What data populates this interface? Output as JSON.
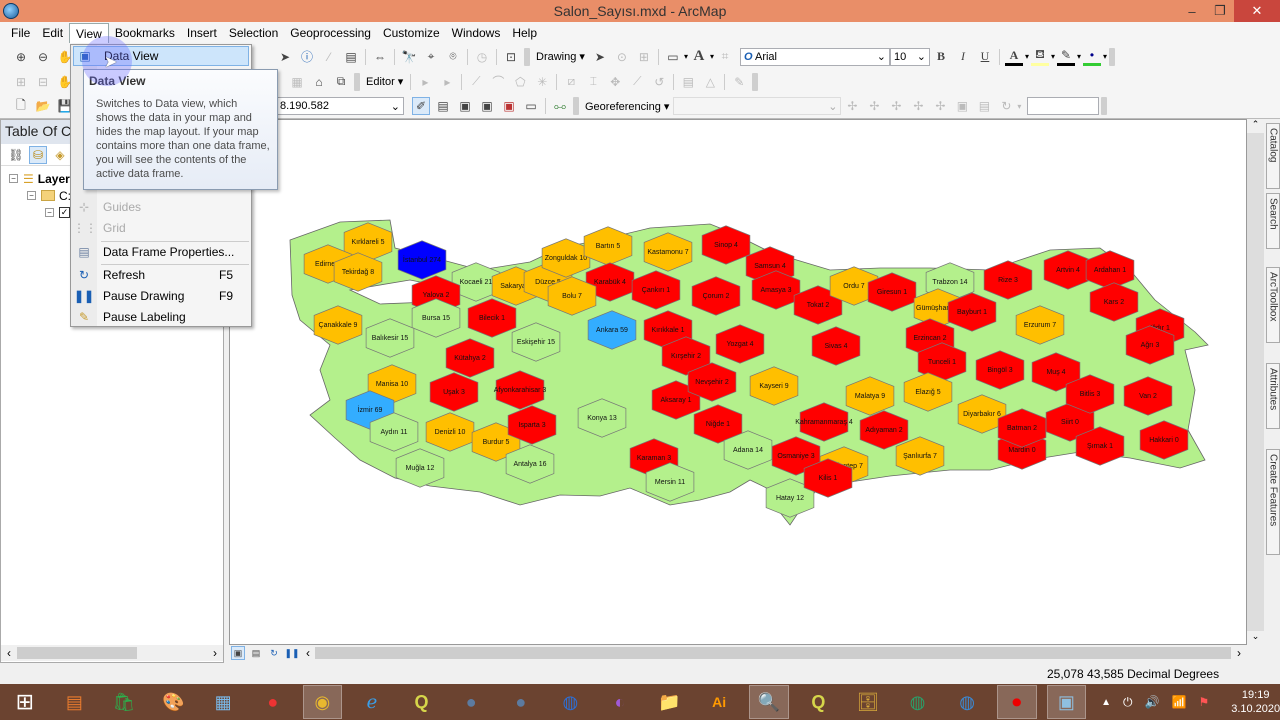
{
  "window": {
    "title": "Salon_Sayısı.mxd - ArcMap",
    "minimize": "–",
    "restore": "❐",
    "close": "✕"
  },
  "menu": [
    "File",
    "Edit",
    "View",
    "Bookmarks",
    "Insert",
    "Selection",
    "Geoprocessing",
    "Customize",
    "Windows",
    "Help"
  ],
  "toolbar": {
    "drawing_label": "Drawing",
    "font_name": "Arial",
    "font_size": "10",
    "bold": "B",
    "italic": "I",
    "underline": "U",
    "editor_label": "Editor",
    "scale_value": "8.190.582",
    "georef_label": "Georeferencing",
    "georef_layer": ""
  },
  "view_menu": {
    "items": [
      {
        "label": "Data View",
        "icon": "data-view-icon",
        "highlight": true
      },
      {
        "label": "Guides",
        "icon": "guides-icon",
        "disabled": true
      },
      {
        "label": "Grid",
        "icon": "grid-icon",
        "disabled": true
      },
      {
        "label": "Data Frame Properties...",
        "icon": "data-frame-properties-icon"
      },
      {
        "label": "Refresh",
        "icon": "refresh-icon",
        "shortcut": "F5"
      },
      {
        "label": "Pause Drawing",
        "icon": "pause-icon",
        "shortcut": "F9"
      },
      {
        "label": "Pause Labeling",
        "icon": "pause-labeling-icon"
      }
    ]
  },
  "tooltip": {
    "title": "Data View",
    "body": "Switches to Data view, which shows the data in your map and hides the map layout. If your map contains more than one data frame, you will see the contents of the active data frame."
  },
  "toc": {
    "title": "Table Of C",
    "layers_label": "Layer",
    "folder_label": "C:"
  },
  "side_tabs": [
    "Catalog",
    "Search",
    "ArcToolbox",
    "Attributes",
    "Create Features"
  ],
  "status": {
    "coords": "25,078  43,585 Decimal Degrees"
  },
  "taskbar": {
    "time": "19:19",
    "date": "3.10.2020"
  },
  "map": {
    "legend_colors": {
      "very_high": "#0000ff",
      "high": "#33adff",
      "medium": "#b4f08c",
      "low": "#ffbf00",
      "very_low": "#ff0000"
    },
    "provinces": [
      {
        "name": "Kırklareli",
        "value": 5,
        "cls": "low"
      },
      {
        "name": "Edirne",
        "value": 6,
        "cls": "low"
      },
      {
        "name": "Tekirdağ",
        "value": 8,
        "cls": "low"
      },
      {
        "name": "İstanbul",
        "value": 274,
        "cls": "very_high"
      },
      {
        "name": "Kocaeli",
        "value": 21,
        "cls": "medium"
      },
      {
        "name": "Yalova",
        "value": 2,
        "cls": "very_low"
      },
      {
        "name": "Sakarya",
        "value": 7,
        "cls": "low"
      },
      {
        "name": "Düzce",
        "value": 5,
        "cls": "low"
      },
      {
        "name": "Zonguldak",
        "value": 10,
        "cls": "low"
      },
      {
        "name": "Bartın",
        "value": 5,
        "cls": "low"
      },
      {
        "name": "Karabük",
        "value": 4,
        "cls": "very_low"
      },
      {
        "name": "Kastamonu",
        "value": 7,
        "cls": "low"
      },
      {
        "name": "Sinop",
        "value": 4,
        "cls": "very_low"
      },
      {
        "name": "Samsun",
        "value": 4,
        "cls": "very_low"
      },
      {
        "name": "Bolu",
        "value": 7,
        "cls": "low"
      },
      {
        "name": "Çanakkale",
        "value": 9,
        "cls": "low"
      },
      {
        "name": "Bursa",
        "value": 15,
        "cls": "medium"
      },
      {
        "name": "Balıkesir",
        "value": 15,
        "cls": "medium"
      },
      {
        "name": "Bilecik",
        "value": 1,
        "cls": "very_low"
      },
      {
        "name": "Eskişehir",
        "value": 15,
        "cls": "medium"
      },
      {
        "name": "Ankara",
        "value": 59,
        "cls": "high"
      },
      {
        "name": "Çankırı",
        "value": 1,
        "cls": "very_low"
      },
      {
        "name": "Çorum",
        "value": 2,
        "cls": "very_low"
      },
      {
        "name": "Amasya",
        "value": 3,
        "cls": "very_low"
      },
      {
        "name": "Tokat",
        "value": 2,
        "cls": "very_low"
      },
      {
        "name": "Ordu",
        "value": 7,
        "cls": "low"
      },
      {
        "name": "Giresun",
        "value": 1,
        "cls": "very_low"
      },
      {
        "name": "Trabzon",
        "value": 14,
        "cls": "medium"
      },
      {
        "name": "Rize",
        "value": 3,
        "cls": "very_low"
      },
      {
        "name": "Artvin",
        "value": 4,
        "cls": "very_low"
      },
      {
        "name": "Ardahan",
        "value": 1,
        "cls": "very_low"
      },
      {
        "name": "Gümüşhane",
        "value": 6,
        "cls": "low"
      },
      {
        "name": "Bayburt",
        "value": 1,
        "cls": "very_low"
      },
      {
        "name": "Erzurum",
        "value": 7,
        "cls": "low"
      },
      {
        "name": "Kars",
        "value": 2,
        "cls": "very_low"
      },
      {
        "name": "Iğdır",
        "value": 1,
        "cls": "very_low"
      },
      {
        "name": "Ağrı",
        "value": 3,
        "cls": "very_low"
      },
      {
        "name": "Kırıkkale",
        "value": 1,
        "cls": "very_low"
      },
      {
        "name": "Yozgat",
        "value": 4,
        "cls": "very_low"
      },
      {
        "name": "Sivas",
        "value": 4,
        "cls": "very_low"
      },
      {
        "name": "Erzincan",
        "value": 2,
        "cls": "very_low"
      },
      {
        "name": "Tunceli",
        "value": 1,
        "cls": "very_low"
      },
      {
        "name": "Bingöl",
        "value": 3,
        "cls": "very_low"
      },
      {
        "name": "Muş",
        "value": 4,
        "cls": "very_low"
      },
      {
        "name": "Kırşehir",
        "value": 2,
        "cls": "very_low"
      },
      {
        "name": "Kütahya",
        "value": 2,
        "cls": "very_low"
      },
      {
        "name": "Manisa",
        "value": 10,
        "cls": "low"
      },
      {
        "name": "İzmir",
        "value": 69,
        "cls": "high"
      },
      {
        "name": "Uşak",
        "value": 3,
        "cls": "very_low"
      },
      {
        "name": "Afyonkarahisar",
        "value": 3,
        "cls": "very_low"
      },
      {
        "name": "Aydın",
        "value": 11,
        "cls": "medium"
      },
      {
        "name": "Denizli",
        "value": 10,
        "cls": "low"
      },
      {
        "name": "Burdur",
        "value": 5,
        "cls": "low"
      },
      {
        "name": "Isparta",
        "value": 3,
        "cls": "very_low"
      },
      {
        "name": "Muğla",
        "value": 12,
        "cls": "medium"
      },
      {
        "name": "Antalya",
        "value": 16,
        "cls": "medium"
      },
      {
        "name": "Konya",
        "value": 13,
        "cls": "medium"
      },
      {
        "name": "Aksaray",
        "value": 1,
        "cls": "very_low"
      },
      {
        "name": "Nevşehir",
        "value": 2,
        "cls": "very_low"
      },
      {
        "name": "Niğde",
        "value": 1,
        "cls": "very_low"
      },
      {
        "name": "Kayseri",
        "value": 9,
        "cls": "low"
      },
      {
        "name": "Karaman",
        "value": 3,
        "cls": "very_low"
      },
      {
        "name": "Mersin",
        "value": 11,
        "cls": "medium"
      },
      {
        "name": "Adana",
        "value": 14,
        "cls": "medium"
      },
      {
        "name": "Osmaniye",
        "value": 3,
        "cls": "very_low"
      },
      {
        "name": "Hatay",
        "value": 12,
        "cls": "medium"
      },
      {
        "name": "Kahramanmaraş",
        "value": 4,
        "cls": "very_low"
      },
      {
        "name": "Gaziantep",
        "value": 7,
        "cls": "low"
      },
      {
        "name": "Kilis",
        "value": 1,
        "cls": "very_low"
      },
      {
        "name": "Malatya",
        "value": 9,
        "cls": "low"
      },
      {
        "name": "Adıyaman",
        "value": 2,
        "cls": "very_low"
      },
      {
        "name": "Şanlıurfa",
        "value": 7,
        "cls": "low"
      },
      {
        "name": "Elazığ",
        "value": 5,
        "cls": "low"
      },
      {
        "name": "Diyarbakır",
        "value": 6,
        "cls": "low"
      },
      {
        "name": "Mardin",
        "value": 0,
        "cls": "very_low"
      },
      {
        "name": "Batman",
        "value": 2,
        "cls": "very_low"
      },
      {
        "name": "Siirt",
        "value": 0,
        "cls": "very_low"
      },
      {
        "name": "Şırnak",
        "value": 1,
        "cls": "very_low"
      },
      {
        "name": "Bitlis",
        "value": 3,
        "cls": "very_low"
      },
      {
        "name": "Van",
        "value": 2,
        "cls": "very_low"
      },
      {
        "name": "Hakkari",
        "value": 0,
        "cls": "very_low"
      }
    ]
  }
}
